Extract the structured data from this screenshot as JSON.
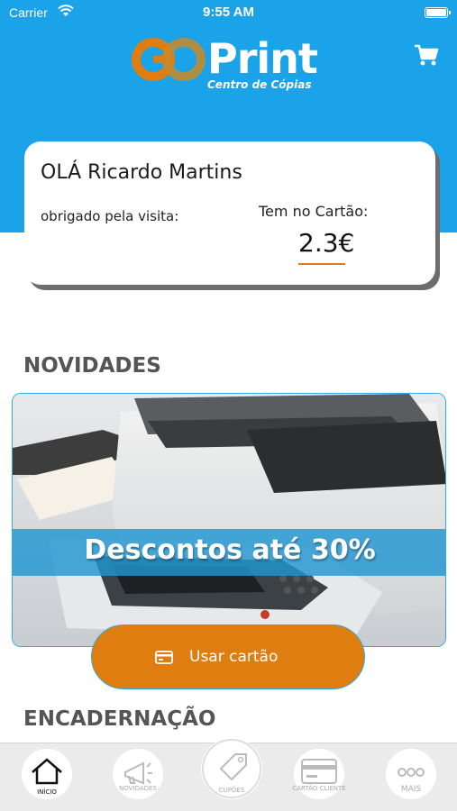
{
  "status_bar": {
    "carrier": "Carrier",
    "time": "9:55 AM"
  },
  "header": {
    "logo_go": "GO",
    "logo_print": "Print",
    "logo_subtitle": "Centro de Cópias",
    "cart_icon": "cart-icon"
  },
  "account_card": {
    "greeting": "OLÁ Ricardo Martins",
    "thanks": "obrigado pela visita:",
    "balance_label": "Tem no Cartão:",
    "balance_value": "2.3€"
  },
  "sections": {
    "news_title": "NOVIDADES",
    "binding_title": "ENCADERNAÇÃO"
  },
  "banner": {
    "promo_text": "Descontos até 30%"
  },
  "use_card_button": {
    "label": "Usar cartão",
    "icon": "credit-card-icon"
  },
  "tabbar": {
    "items": [
      {
        "label": "INÍCIO",
        "icon": "home-icon",
        "active": true
      },
      {
        "label": "NOVIDADES",
        "icon": "megaphone-icon",
        "active": false
      },
      {
        "label": "CUPÕES",
        "icon": "tag-icon",
        "active": false
      },
      {
        "label": "CARTÃO CLIENTE",
        "icon": "credit-card-icon",
        "active": false
      },
      {
        "label": "MAIS",
        "icon": "more-icon",
        "active": false
      }
    ]
  },
  "colors": {
    "brand_blue": "#1aa3e8",
    "accent_orange": "#e07d10"
  }
}
